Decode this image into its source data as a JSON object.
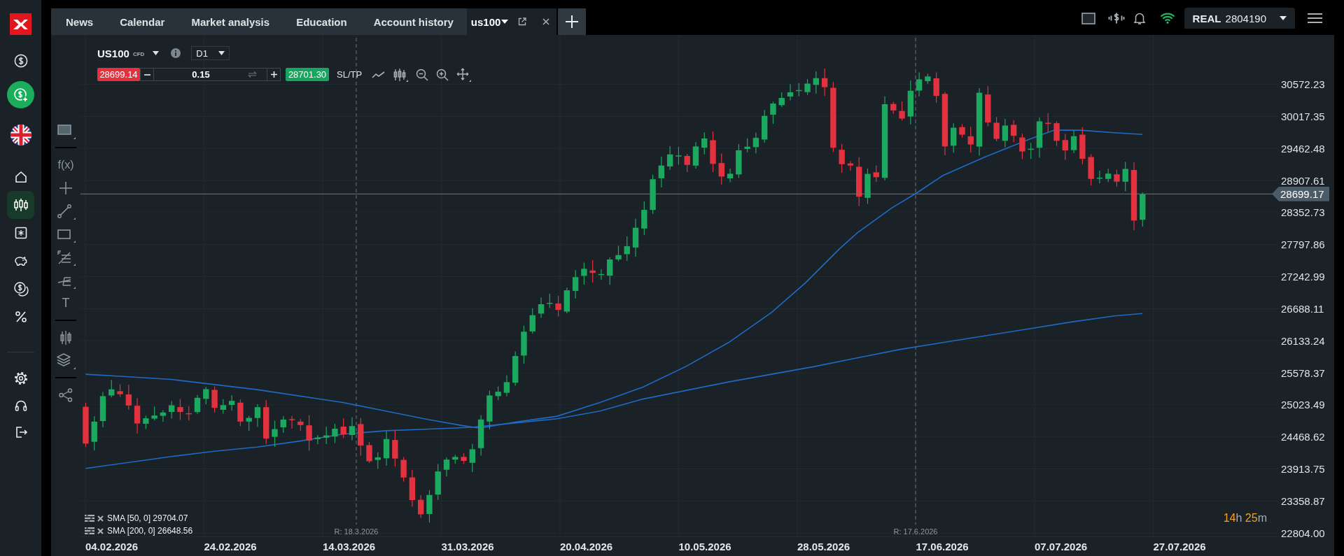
{
  "sidebar": {
    "nav": [
      {
        "kind": "home",
        "selected": false
      },
      {
        "kind": "trading",
        "selected": true
      },
      {
        "kind": "screener",
        "selected": false
      },
      {
        "kind": "savings",
        "selected": false
      },
      {
        "kind": "coins",
        "selected": false
      },
      {
        "kind": "percent",
        "selected": false
      }
    ]
  },
  "tabs": [
    {
      "label": "News",
      "kind": "page",
      "selected": false
    },
    {
      "label": "Calendar",
      "kind": "page",
      "selected": false
    },
    {
      "label": "Market analysis",
      "kind": "page",
      "selected": false
    },
    {
      "label": "Education",
      "kind": "page",
      "selected": false
    },
    {
      "label": "Account history",
      "kind": "page",
      "selected": false
    },
    {
      "label": "us100",
      "kind": "chart",
      "selected": true
    }
  ],
  "account": {
    "type": "REAL",
    "number": "2804190"
  },
  "chart": {
    "symbol": "US100",
    "instrument_type": "CFD",
    "timeframe": "D1",
    "sell_price": "28699.14",
    "volume": "0.15",
    "buy_price": "28701.30",
    "sl_tp": "SL/TP",
    "tool_groups": [
      [
        {
          "kind": "screen"
        }
      ],
      [
        {
          "kind": "indicators",
          "label": "f(x)"
        },
        {
          "kind": "crosshair"
        },
        {
          "kind": "line"
        },
        {
          "kind": "rectangle"
        },
        {
          "kind": "levels"
        },
        {
          "kind": "pitchfork"
        },
        {
          "kind": "text",
          "label": "T"
        }
      ],
      [
        {
          "kind": "candles"
        },
        {
          "kind": "layers"
        }
      ],
      [
        {
          "kind": "share"
        }
      ]
    ],
    "price_labels": [
      "30572.23",
      "30017.35",
      "29462.48",
      "28907.61",
      "28352.73",
      "27797.86",
      "27242.99",
      "26688.11",
      "26133.24",
      "25578.37",
      "25023.49",
      "24468.62",
      "23913.75",
      "23358.87",
      "22804.00"
    ],
    "current_price": "28699.17",
    "date_labels": [
      "04.02.2026",
      "24.02.2026",
      "14.03.2026",
      "31.03.2026",
      "20.04.2026",
      "10.05.2026",
      "28.05.2026",
      "17.06.2026",
      "07.07.2026",
      "27.07.2026"
    ],
    "markers": [
      {
        "label": "R: 18.3.2026"
      },
      {
        "label": "R: 17.6.2026"
      }
    ],
    "indicators": [
      {
        "label": "SMA [50, 0] 29704.07"
      },
      {
        "label": "SMA [200, 0] 26648.56"
      }
    ],
    "countdown": [
      {
        "value": "14",
        "unit": "h"
      },
      {
        "value": "25",
        "unit": "m"
      }
    ]
  }
}
